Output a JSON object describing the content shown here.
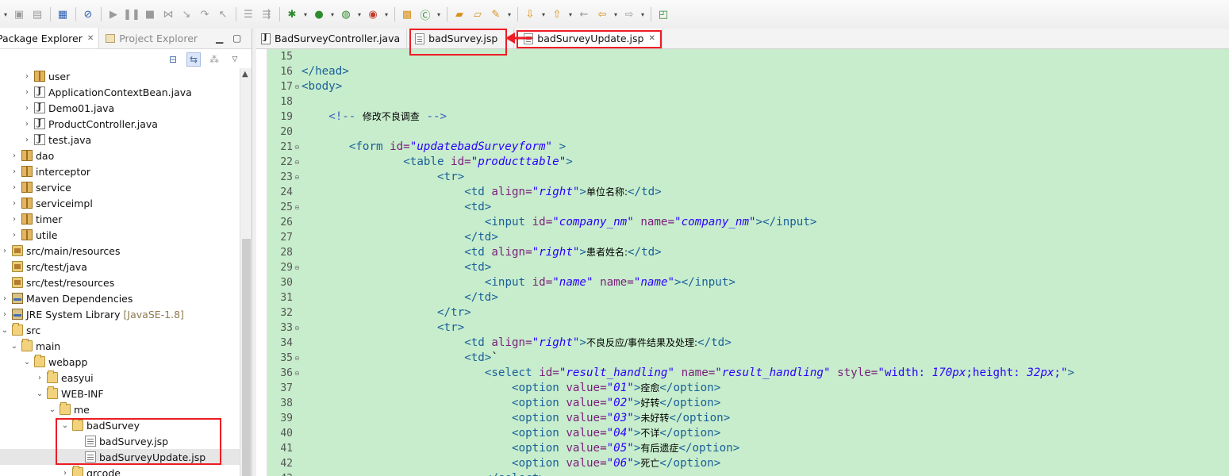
{
  "toolbar": {
    "icons": [
      "new-dropdown-icon",
      "save-icon",
      "save-all-icon",
      "print-icon",
      "toggle-mark-occurrences-icon",
      "skip-breakpoints-icon",
      "resume-icon",
      "suspend-icon",
      "terminate-icon",
      "disconnect-icon",
      "step-into-icon",
      "step-over-icon",
      "step-return-icon",
      "drop-to-frame-icon",
      "use-step-filters-icon",
      "debug-icon",
      "run-icon",
      "external-tools-icon",
      "new-java-package-icon",
      "new-java-class-icon",
      "open-type-icon",
      "open-task-icon",
      "search-icon",
      "next-annotation-icon",
      "previous-annotation-icon",
      "last-edit-location-icon",
      "back-icon",
      "forward-icon",
      "pin-editor-icon"
    ]
  },
  "left_panel": {
    "tabs": [
      {
        "label": "Package Explorer",
        "active": true
      },
      {
        "label": "Project Explorer",
        "active": false
      }
    ],
    "tree": [
      {
        "label": "user",
        "icon": "package-icon",
        "indent": 2,
        "expanded": false
      },
      {
        "label": "ApplicationContextBean.java",
        "icon": "java-file-icon",
        "indent": 2,
        "expanded": false
      },
      {
        "label": "Demo01.java",
        "icon": "java-file-icon",
        "indent": 2,
        "expanded": false
      },
      {
        "label": "ProductController.java",
        "icon": "java-file-icon",
        "indent": 2,
        "expanded": false
      },
      {
        "label": "test.java",
        "icon": "java-file-icon",
        "indent": 2,
        "expanded": false
      },
      {
        "label": "dao",
        "icon": "package-icon",
        "indent": 1,
        "expanded": false
      },
      {
        "label": "interceptor",
        "icon": "package-icon",
        "indent": 1,
        "expanded": false
      },
      {
        "label": "service",
        "icon": "package-icon",
        "indent": 1,
        "expanded": false
      },
      {
        "label": "serviceimpl",
        "icon": "package-icon",
        "indent": 1,
        "expanded": false
      },
      {
        "label": "timer",
        "icon": "package-icon",
        "indent": 1,
        "expanded": false
      },
      {
        "label": "utile",
        "icon": "package-icon",
        "indent": 1,
        "expanded": false
      },
      {
        "label": "src/main/resources",
        "icon": "source-folder-icon",
        "indent": 0,
        "expanded": false
      },
      {
        "label": "src/test/java",
        "icon": "source-folder-icon",
        "indent": 0,
        "expanded": null
      },
      {
        "label": "src/test/resources",
        "icon": "source-folder-icon",
        "indent": 0,
        "expanded": null
      },
      {
        "label": "Maven Dependencies",
        "icon": "library-icon",
        "indent": 0,
        "expanded": false
      },
      {
        "label": "JRE System Library",
        "icon": "library-icon",
        "indent": 0,
        "expanded": false,
        "suffix": "[JavaSE-1.8]"
      },
      {
        "label": "src",
        "icon": "folder-icon",
        "indent": 0,
        "expanded": true
      },
      {
        "label": "main",
        "icon": "folder-icon",
        "indent": 1,
        "expanded": true
      },
      {
        "label": "webapp",
        "icon": "folder-icon",
        "indent": 2,
        "expanded": true
      },
      {
        "label": "easyui",
        "icon": "folder-icon",
        "indent": 3,
        "expanded": false
      },
      {
        "label": "WEB-INF",
        "icon": "folder-icon",
        "indent": 3,
        "expanded": true
      },
      {
        "label": "me",
        "icon": "folder-icon",
        "indent": 4,
        "expanded": true
      },
      {
        "label": "badSurvey",
        "icon": "folder-icon",
        "indent": 5,
        "expanded": true
      },
      {
        "label": "badSurvey.jsp",
        "icon": "jsp-file-icon",
        "indent": 6,
        "expanded": null
      },
      {
        "label": "badSurveyUpdate.jsp",
        "icon": "jsp-file-icon",
        "indent": 6,
        "expanded": null,
        "selected": true
      },
      {
        "label": "qrcode",
        "icon": "folder-icon",
        "indent": 5,
        "expanded": false
      }
    ]
  },
  "editor": {
    "tabs": [
      {
        "label": "BadSurveyController.java",
        "icon": "java-file-icon",
        "active": false,
        "closable": false
      },
      {
        "label": "badSurvey.jsp",
        "icon": "jsp-file-icon",
        "active": false,
        "closable": false
      },
      {
        "label": "badSurveyUpdate.jsp",
        "icon": "jsp-file-icon",
        "active": true,
        "closable": true
      }
    ],
    "lines": [
      {
        "n": "15",
        "fold": false,
        "indent": 0,
        "tokens": []
      },
      {
        "n": "16",
        "fold": false,
        "indent": 0,
        "tokens": [
          {
            "t": "</head>",
            "k": "tag"
          }
        ]
      },
      {
        "n": "17",
        "fold": true,
        "indent": 0,
        "tokens": [
          {
            "t": "<body>",
            "k": "tag"
          }
        ]
      },
      {
        "n": "18",
        "fold": false,
        "indent": 0,
        "tokens": []
      },
      {
        "n": "19",
        "fold": false,
        "indent": 4,
        "tokens": [
          {
            "t": "<!-- ",
            "k": "com"
          },
          {
            "t": "修改不良调查",
            "k": "comcjk"
          },
          {
            "t": " -->",
            "k": "com"
          }
        ]
      },
      {
        "n": "20",
        "fold": false,
        "indent": 0,
        "tokens": []
      },
      {
        "n": "21",
        "fold": true,
        "indent": 7,
        "tokens": [
          {
            "t": "<form ",
            "k": "tag"
          },
          {
            "t": "id=",
            "k": "attr"
          },
          {
            "t": "\"updatebadSurveyform\"",
            "k": "val"
          },
          {
            "t": " >",
            "k": "tag"
          }
        ]
      },
      {
        "n": "22",
        "fold": true,
        "indent": 15,
        "tokens": [
          {
            "t": "<table ",
            "k": "tag"
          },
          {
            "t": "id=",
            "k": "attr"
          },
          {
            "t": "\"producttable\"",
            "k": "val"
          },
          {
            "t": ">",
            "k": "tag"
          }
        ]
      },
      {
        "n": "23",
        "fold": true,
        "indent": 20,
        "tokens": [
          {
            "t": "<tr>",
            "k": "tag"
          }
        ]
      },
      {
        "n": "24",
        "fold": false,
        "indent": 24,
        "tokens": [
          {
            "t": "<td ",
            "k": "tag"
          },
          {
            "t": "align=",
            "k": "attr"
          },
          {
            "t": "\"right\"",
            "k": "val"
          },
          {
            "t": ">",
            "k": "tag"
          },
          {
            "t": "单位名称:",
            "k": "cjk"
          },
          {
            "t": "</td>",
            "k": "tag"
          }
        ]
      },
      {
        "n": "25",
        "fold": true,
        "indent": 24,
        "tokens": [
          {
            "t": "<td>",
            "k": "tag"
          }
        ]
      },
      {
        "n": "26",
        "fold": false,
        "indent": 27,
        "tokens": [
          {
            "t": "<input ",
            "k": "tag"
          },
          {
            "t": "id=",
            "k": "attr"
          },
          {
            "t": "\"company_nm\"",
            "k": "val"
          },
          {
            "t": " ",
            "k": "plain"
          },
          {
            "t": "name=",
            "k": "attr"
          },
          {
            "t": "\"company_nm\"",
            "k": "val"
          },
          {
            "t": "></input>",
            "k": "tag"
          }
        ]
      },
      {
        "n": "27",
        "fold": false,
        "indent": 24,
        "tokens": [
          {
            "t": "</td>",
            "k": "tag"
          }
        ]
      },
      {
        "n": "28",
        "fold": false,
        "indent": 24,
        "tokens": [
          {
            "t": "<td ",
            "k": "tag"
          },
          {
            "t": "align=",
            "k": "attr"
          },
          {
            "t": "\"right\"",
            "k": "val"
          },
          {
            "t": ">",
            "k": "tag"
          },
          {
            "t": "患者姓名:",
            "k": "cjk"
          },
          {
            "t": "</td>",
            "k": "tag"
          }
        ]
      },
      {
        "n": "29",
        "fold": true,
        "indent": 24,
        "tokens": [
          {
            "t": "<td>",
            "k": "tag"
          }
        ]
      },
      {
        "n": "30",
        "fold": false,
        "indent": 27,
        "tokens": [
          {
            "t": "<input ",
            "k": "tag"
          },
          {
            "t": "id=",
            "k": "attr"
          },
          {
            "t": "\"name\"",
            "k": "val"
          },
          {
            "t": " ",
            "k": "plain"
          },
          {
            "t": "name=",
            "k": "attr"
          },
          {
            "t": "\"name\"",
            "k": "val"
          },
          {
            "t": "></input>",
            "k": "tag"
          }
        ]
      },
      {
        "n": "31",
        "fold": false,
        "indent": 24,
        "tokens": [
          {
            "t": "</td>",
            "k": "tag"
          }
        ]
      },
      {
        "n": "32",
        "fold": false,
        "indent": 20,
        "tokens": [
          {
            "t": "</tr>",
            "k": "tag"
          }
        ]
      },
      {
        "n": "33",
        "fold": true,
        "indent": 20,
        "tokens": [
          {
            "t": "<tr>",
            "k": "tag"
          }
        ]
      },
      {
        "n": "34",
        "fold": false,
        "indent": 24,
        "tokens": [
          {
            "t": "<td ",
            "k": "tag"
          },
          {
            "t": "align=",
            "k": "attr"
          },
          {
            "t": "\"right\"",
            "k": "val"
          },
          {
            "t": ">",
            "k": "tag"
          },
          {
            "t": "不良反应/事件结果及处理:",
            "k": "cjk"
          },
          {
            "t": "</td>",
            "k": "tag"
          }
        ]
      },
      {
        "n": "35",
        "fold": true,
        "indent": 24,
        "tokens": [
          {
            "t": "<td>",
            "k": "tag"
          },
          {
            "t": "`",
            "k": "plain"
          }
        ]
      },
      {
        "n": "36",
        "fold": true,
        "indent": 27,
        "tokens": [
          {
            "t": "<select ",
            "k": "tag"
          },
          {
            "t": "id=",
            "k": "attr"
          },
          {
            "t": "\"result_handling\"",
            "k": "val"
          },
          {
            "t": " ",
            "k": "plain"
          },
          {
            "t": "name=",
            "k": "attr"
          },
          {
            "t": "\"result_handling\"",
            "k": "val"
          },
          {
            "t": " ",
            "k": "plain"
          },
          {
            "t": "style=",
            "k": "attr"
          },
          {
            "t": "\"width: ",
            "k": "str"
          },
          {
            "t": "170px",
            "k": "val"
          },
          {
            "t": ";height: ",
            "k": "str"
          },
          {
            "t": "32px",
            "k": "val"
          },
          {
            "t": ";\"",
            "k": "str"
          },
          {
            "t": ">",
            "k": "tag"
          }
        ]
      },
      {
        "n": "37",
        "fold": false,
        "indent": 31,
        "tokens": [
          {
            "t": "<option ",
            "k": "tag"
          },
          {
            "t": "value=",
            "k": "attr"
          },
          {
            "t": "\"01\"",
            "k": "val"
          },
          {
            "t": ">",
            "k": "tag"
          },
          {
            "t": "痊愈",
            "k": "cjk"
          },
          {
            "t": "</option>",
            "k": "tag"
          }
        ]
      },
      {
        "n": "38",
        "fold": false,
        "indent": 31,
        "tokens": [
          {
            "t": "<option ",
            "k": "tag"
          },
          {
            "t": "value=",
            "k": "attr"
          },
          {
            "t": "\"02\"",
            "k": "val"
          },
          {
            "t": ">",
            "k": "tag"
          },
          {
            "t": "好转",
            "k": "cjk"
          },
          {
            "t": "</option>",
            "k": "tag"
          }
        ]
      },
      {
        "n": "39",
        "fold": false,
        "indent": 31,
        "tokens": [
          {
            "t": "<option ",
            "k": "tag"
          },
          {
            "t": "value=",
            "k": "attr"
          },
          {
            "t": "\"03\"",
            "k": "val"
          },
          {
            "t": ">",
            "k": "tag"
          },
          {
            "t": "未好转",
            "k": "cjk"
          },
          {
            "t": "</option>",
            "k": "tag"
          }
        ]
      },
      {
        "n": "40",
        "fold": false,
        "indent": 31,
        "tokens": [
          {
            "t": "<option ",
            "k": "tag"
          },
          {
            "t": "value=",
            "k": "attr"
          },
          {
            "t": "\"04\"",
            "k": "val"
          },
          {
            "t": ">",
            "k": "tag"
          },
          {
            "t": "不详",
            "k": "cjk"
          },
          {
            "t": "</option>",
            "k": "tag"
          }
        ]
      },
      {
        "n": "41",
        "fold": false,
        "indent": 31,
        "tokens": [
          {
            "t": "<option ",
            "k": "tag"
          },
          {
            "t": "value=",
            "k": "attr"
          },
          {
            "t": "\"05\"",
            "k": "val"
          },
          {
            "t": ">",
            "k": "tag"
          },
          {
            "t": "有后遗症",
            "k": "cjk"
          },
          {
            "t": "</option>",
            "k": "tag"
          }
        ]
      },
      {
        "n": "42",
        "fold": false,
        "indent": 31,
        "tokens": [
          {
            "t": "<option ",
            "k": "tag"
          },
          {
            "t": "value=",
            "k": "attr"
          },
          {
            "t": "\"06\"",
            "k": "val"
          },
          {
            "t": ">",
            "k": "tag"
          },
          {
            "t": "死亡",
            "k": "cjk"
          },
          {
            "t": "</option>",
            "k": "tag"
          }
        ]
      },
      {
        "n": "43",
        "fold": false,
        "indent": 27,
        "tokens": [
          {
            "t": "</select>",
            "k": "tag"
          }
        ]
      }
    ]
  },
  "colors": {
    "editor_bg": "#c7edcc",
    "annotation_red": "#ee1c24"
  }
}
